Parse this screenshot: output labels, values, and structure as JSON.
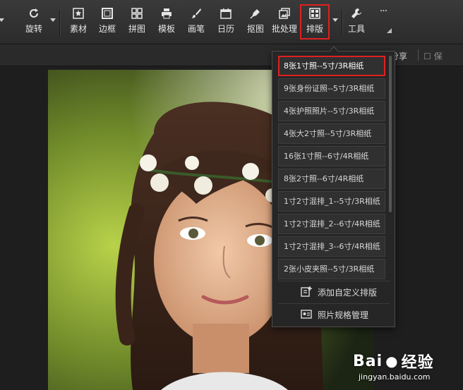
{
  "toolbar": {
    "tools": [
      {
        "name": "rotate",
        "label": "旋转",
        "icon": "rotate-icon"
      },
      {
        "name": "material",
        "label": "素材",
        "icon": "star-icon"
      },
      {
        "name": "border",
        "label": "边框",
        "icon": "frame-icon"
      },
      {
        "name": "collage",
        "label": "拼图",
        "icon": "grid-icon"
      },
      {
        "name": "template",
        "label": "模板",
        "icon": "printer-icon"
      },
      {
        "name": "brush",
        "label": "画笔",
        "icon": "brush-icon"
      },
      {
        "name": "calendar",
        "label": "日历",
        "icon": "calendar-icon"
      },
      {
        "name": "cutout",
        "label": "抠图",
        "icon": "pen-icon"
      },
      {
        "name": "batch",
        "label": "批处理",
        "icon": "layers-icon"
      },
      {
        "name": "layout",
        "label": "排版",
        "icon": "layout-icon"
      },
      {
        "name": "tools",
        "label": "工具",
        "icon": "wrench-icon"
      }
    ],
    "more_label": "···",
    "colors": {
      "highlight": "#e02020",
      "bg": "#2f2f2f"
    }
  },
  "subbar": {
    "share_label": "分享",
    "cut_label": "保"
  },
  "menu": {
    "items": [
      "8张1寸照--5寸/3R相纸",
      "9张身份证照--5寸/3R相纸",
      "4张护照照片--5寸/3R相纸",
      "4张大2寸照--5寸/3R相纸",
      "16张1寸照--6寸/4R相纸",
      "8张2寸照--6寸/4R相纸",
      "1寸2寸混排_1--5寸/3R相纸",
      "1寸2寸混排_2--6寸/4R相纸",
      "1寸2寸混排_3--6寸/4R相纸",
      "2张小皮夹照--5寸/3R相纸"
    ],
    "selected_index": 0,
    "add_custom_label": "添加自定义排版",
    "manage_label": "照片规格管理"
  },
  "watermark": {
    "brand": "Bai",
    "brand2": "经验",
    "url": "jingyan.baidu.com"
  }
}
